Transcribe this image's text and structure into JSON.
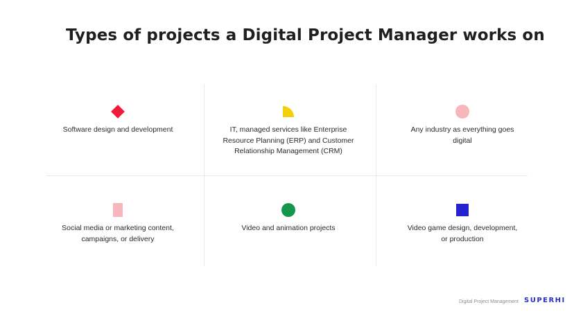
{
  "title": "Types of projects a Digital Project Manager works on",
  "items": [
    {
      "text": "Software design and development",
      "icon": "red-diamond-icon",
      "color": "#ee1c3a"
    },
    {
      "text": "IT, managed services like Enterprise Resource Planning (ERP) and Customer Relationship Management (CRM)",
      "icon": "yellow-quarter-circle-icon",
      "color": "#f5cf0a"
    },
    {
      "text": "Any industry as everything goes digital",
      "icon": "pink-circle-icon",
      "color": "#f7b6bc"
    },
    {
      "text": "Social media or marketing content, campaigns, or delivery",
      "icon": "pink-rectangle-icon",
      "color": "#f7b6bc"
    },
    {
      "text": "Video and animation projects",
      "icon": "green-circle-icon",
      "color": "#16964b"
    },
    {
      "text": "Video game design, development, or production",
      "icon": "blue-square-icon",
      "color": "#2522cf"
    }
  ],
  "footer": {
    "label": "Digital Project Management",
    "logo": "SUPERHI"
  }
}
